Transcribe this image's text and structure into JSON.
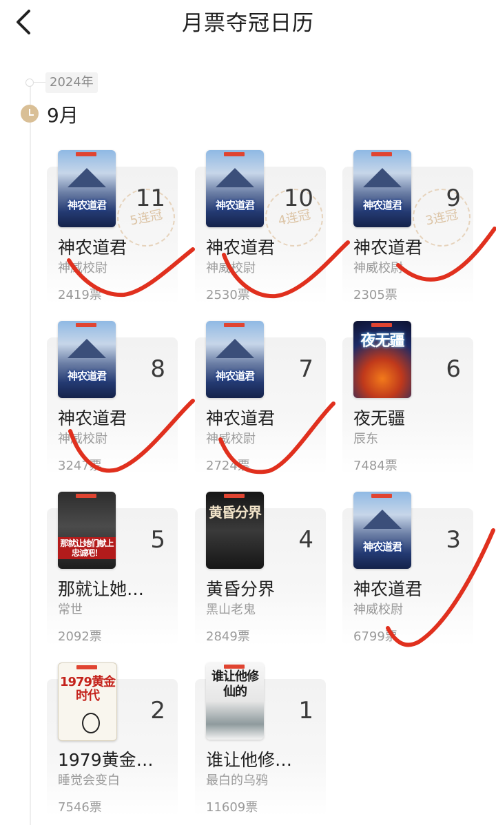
{
  "header": {
    "title": "月票夺冠日历"
  },
  "timeline": {
    "year": "2024年",
    "month": "9月"
  },
  "cards": [
    {
      "day": "11",
      "title": "神农道君",
      "author": "神威校尉",
      "votes": "2419票",
      "streak": "5连冠",
      "cover": "sn",
      "cover_text": "神农道君"
    },
    {
      "day": "10",
      "title": "神农道君",
      "author": "神威校尉",
      "votes": "2530票",
      "streak": "4连冠",
      "cover": "sn",
      "cover_text": "神农道君"
    },
    {
      "day": "9",
      "title": "神农道君",
      "author": "神威校尉",
      "votes": "2305票",
      "streak": "3连冠",
      "cover": "sn",
      "cover_text": "神农道君"
    },
    {
      "day": "8",
      "title": "神农道君",
      "author": "神威校尉",
      "votes": "3247票",
      "streak": "",
      "cover": "sn",
      "cover_text": "神农道君"
    },
    {
      "day": "7",
      "title": "神农道君",
      "author": "神威校尉",
      "votes": "2724票",
      "streak": "",
      "cover": "sn",
      "cover_text": "神农道君"
    },
    {
      "day": "6",
      "title": "夜无疆",
      "author": "辰东",
      "votes": "7484票",
      "streak": "",
      "cover": "yw",
      "cover_text": "夜无疆"
    },
    {
      "day": "5",
      "title": "那就让她…",
      "author": "常世",
      "votes": "2092票",
      "streak": "",
      "cover": "nj",
      "cover_text": "那就让她们献上忠诚吧！"
    },
    {
      "day": "4",
      "title": "黄昏分界",
      "author": "黑山老鬼",
      "votes": "2849票",
      "streak": "",
      "cover": "hh",
      "cover_text": "黄昏分界"
    },
    {
      "day": "3",
      "title": "神农道君",
      "author": "神威校尉",
      "votes": "6799票",
      "streak": "",
      "cover": "sn",
      "cover_text": "神农道君"
    },
    {
      "day": "2",
      "title": "1979黄金…",
      "author": "睡觉会变白",
      "votes": "7546票",
      "streak": "",
      "cover": "79",
      "cover_text": "1979黄金时代"
    },
    {
      "day": "1",
      "title": "谁让他修…",
      "author": "最白的乌鸦",
      "votes": "11609票",
      "streak": "",
      "cover": "sr",
      "cover_text": "谁让他修仙的"
    }
  ],
  "colors": {
    "accent_gold": "#d9bf96",
    "scribble_red": "#e0301e"
  },
  "icons": {
    "back": "chevron-left-icon",
    "month": "clock-icon"
  }
}
